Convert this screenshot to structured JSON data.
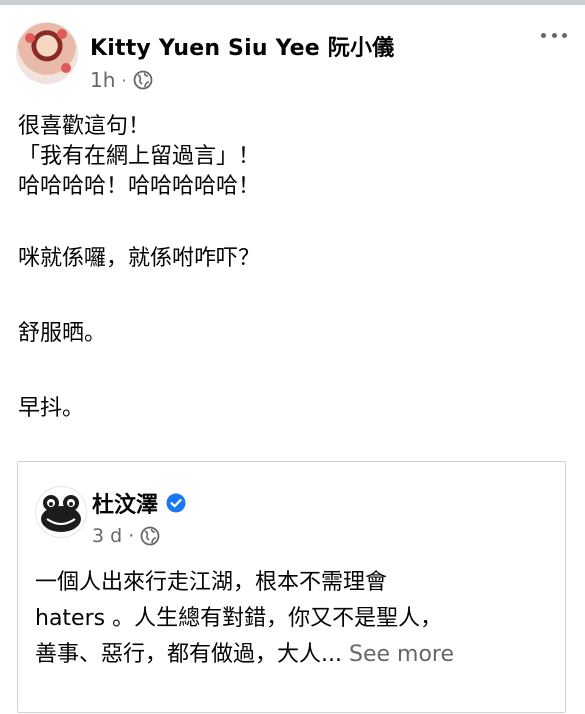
{
  "post": {
    "author": "Kitty Yuen Siu Yee 阮小儀",
    "time": "1h",
    "separator": "·",
    "audience_icon": "globe-icon",
    "menu_icon": "more-options-icon",
    "lines": [
      "很喜歡這句！",
      "「我有在網上留過言」！",
      "哈哈哈哈！哈哈哈哈哈！",
      "咪就係囉，就係咐咋吓？",
      "舒服晒。",
      "早抖。"
    ]
  },
  "shared": {
    "author": "杜汶澤",
    "verified_icon": "verified-badge-icon",
    "time": "3 d",
    "separator": "·",
    "audience_icon": "globe-icon",
    "lines": [
      "一個人出來行走江湖，根本不需理會",
      "haters 。人生總有對錯，你又不是聖人，",
      "善事、惡行，都有做過，大人..."
    ],
    "see_more": "See more"
  },
  "colors": {
    "primary_text": "#050505",
    "secondary_text": "#65676b",
    "verified_blue": "#1877f2",
    "border": "#d0d2d6"
  }
}
